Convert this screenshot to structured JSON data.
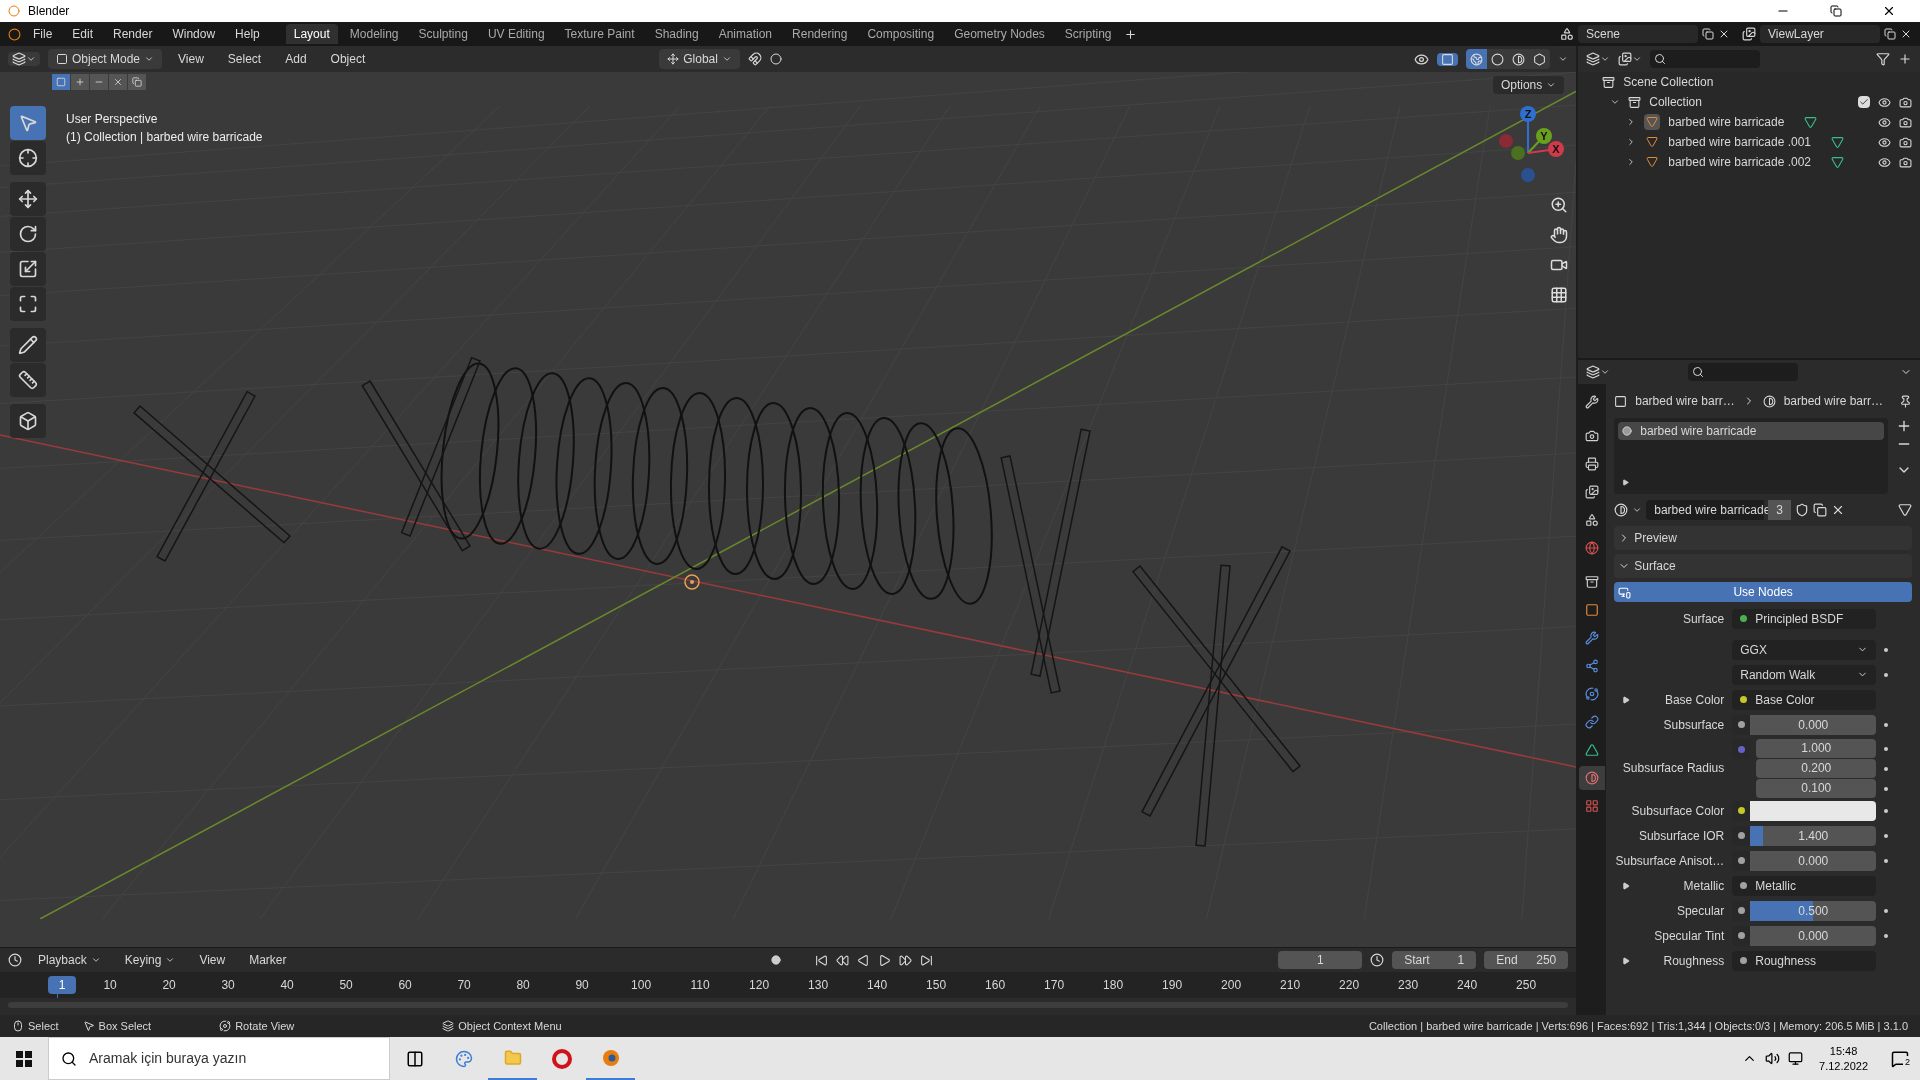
{
  "window": {
    "title": "Blender"
  },
  "menu": [
    "File",
    "Edit",
    "Render",
    "Window",
    "Help"
  ],
  "workspaces": [
    {
      "label": "Layout",
      "selected": true
    },
    {
      "label": "Modeling",
      "selected": false
    },
    {
      "label": "Sculpting",
      "selected": false
    },
    {
      "label": "UV Editing",
      "selected": false
    },
    {
      "label": "Texture Paint",
      "selected": false
    },
    {
      "label": "Shading",
      "selected": false
    },
    {
      "label": "Animation",
      "selected": false
    },
    {
      "label": "Rendering",
      "selected": false
    },
    {
      "label": "Compositing",
      "selected": false
    },
    {
      "label": "Geometry Nodes",
      "selected": false
    },
    {
      "label": "Scripting",
      "selected": false
    }
  ],
  "scene": "Scene",
  "view_layer": "ViewLayer",
  "viewport_header": {
    "mode": "Object Mode",
    "menus": [
      "View",
      "Select",
      "Add",
      "Object"
    ],
    "orientation": "Global",
    "options": "Options",
    "xray": true,
    "shading": [
      {
        "kind": "wireframe",
        "selected": true
      },
      {
        "kind": "solid",
        "selected": false
      },
      {
        "kind": "material",
        "selected": false
      },
      {
        "kind": "rendered",
        "selected": false
      }
    ]
  },
  "select_modes": [
    {
      "kind": "set",
      "selected": true
    },
    {
      "kind": "extend",
      "selected": false
    },
    {
      "kind": "subtract",
      "selected": false
    },
    {
      "kind": "difference",
      "selected": false
    },
    {
      "kind": "intersect",
      "selected": false
    }
  ],
  "viewport": {
    "overlay_lines": [
      "User Perspective",
      "(1) Collection | barbed wire barricade"
    ],
    "gizmo": [
      "Z",
      "Y",
      "X"
    ],
    "tools": [
      {
        "kind": "select",
        "selected": true
      },
      {
        "kind": "cursor",
        "selected": false
      },
      {
        "kind": "move",
        "selected": false
      },
      {
        "kind": "rotate",
        "selected": false
      },
      {
        "kind": "scale",
        "selected": false
      },
      {
        "kind": "transform",
        "selected": false
      },
      {
        "kind": "annotate",
        "selected": false
      },
      {
        "kind": "measure",
        "selected": false
      },
      {
        "kind": "add-cube",
        "selected": false
      }
    ]
  },
  "outliner": {
    "root": "Scene Collection",
    "children": [
      {
        "label": "Collection",
        "expanded": true,
        "checked": true,
        "children": [
          {
            "label": "barbed wire barricade",
            "expanded": false,
            "active": true
          },
          {
            "label": "barbed wire barricade .001",
            "expanded": false,
            "active": false
          },
          {
            "label": "barbed wire barricade .002",
            "expanded": false,
            "active": false
          }
        ]
      }
    ]
  },
  "properties": {
    "tabs": [
      {
        "kind": "tool",
        "selected": false
      },
      {
        "kind": "render",
        "selected": false
      },
      {
        "kind": "output",
        "selected": false
      },
      {
        "kind": "view-layer",
        "selected": false
      },
      {
        "kind": "scene",
        "selected": false
      },
      {
        "kind": "world",
        "selected": false
      },
      {
        "kind": "collection",
        "selected": false
      },
      {
        "kind": "object",
        "selected": false
      },
      {
        "kind": "modifiers",
        "selected": false
      },
      {
        "kind": "particles",
        "selected": false
      },
      {
        "kind": "physics",
        "selected": false
      },
      {
        "kind": "constraints",
        "selected": false
      },
      {
        "kind": "data",
        "selected": false
      },
      {
        "kind": "material",
        "selected": true
      },
      {
        "kind": "texture",
        "selected": false
      }
    ],
    "breadcrumb": [
      "barbed wire barr…",
      "barbed wire barr…"
    ],
    "slots": [
      {
        "label": "barbed wire barricade",
        "selected": true
      }
    ],
    "material": {
      "name": "barbed wire barricade",
      "users": "3"
    },
    "panels": [
      {
        "label": "Preview",
        "expanded": false
      },
      {
        "label": "Surface",
        "expanded": true
      }
    ],
    "use_nodes": "Use Nodes",
    "rows": [
      {
        "kind": "link",
        "label": "Surface",
        "color": "#4caf50",
        "value": "Principled BSDF"
      },
      {
        "kind": "dropdown",
        "value": "GGX"
      },
      {
        "kind": "dropdown",
        "value": "Random Walk"
      },
      {
        "kind": "link",
        "label": "Base Color",
        "color": "#c7c729",
        "value": "Base Color",
        "expandable": true
      },
      {
        "kind": "slider",
        "label": "Subsurface",
        "color": "#a1a1a1",
        "value": "0.000",
        "level": 0
      },
      {
        "kind": "vector",
        "label": "Subsurface Radius",
        "color": "#6363c7",
        "values": [
          "1.000",
          "0.200",
          "0.100"
        ]
      },
      {
        "kind": "swatch",
        "label": "Subsurface Color",
        "color": "#c7c729",
        "swatch": {
          "color": "#e8e8e8"
        }
      },
      {
        "kind": "slider",
        "label": "Subsurface IOR",
        "color": "#a1a1a1",
        "value": "1.400",
        "level": 0.1
      },
      {
        "kind": "slider",
        "label": "Subsurface Anisot…",
        "color": "#a1a1a1",
        "value": "0.000",
        "level": 0
      },
      {
        "kind": "link",
        "label": "Metallic",
        "color": "#a1a1a1",
        "value": "Metallic",
        "expandable": true
      },
      {
        "kind": "slider",
        "label": "Specular",
        "color": "#a1a1a1",
        "value": "0.500",
        "level": 0.5
      },
      {
        "kind": "slider",
        "label": "Specular Tint",
        "color": "#a1a1a1",
        "value": "0.000",
        "level": 0
      },
      {
        "kind": "link",
        "label": "Roughness",
        "color": "#a1a1a1",
        "value": "Roughness",
        "expandable": true
      }
    ]
  },
  "timeline": {
    "menus": [
      "Playback",
      "Keying",
      "View",
      "Marker"
    ],
    "current_frame": "1",
    "start_label": "Start",
    "start": "1",
    "end_label": "End",
    "end": "250",
    "ruler": [
      "1",
      "10",
      "20",
      "30",
      "40",
      "50",
      "60",
      "70",
      "80",
      "90",
      "100",
      "110",
      "120",
      "130",
      "140",
      "150",
      "160",
      "170",
      "180",
      "190",
      "200",
      "210",
      "220",
      "230",
      "240",
      "250"
    ]
  },
  "status_bar": {
    "hints": [
      {
        "kind": "left-click",
        "label": "Select"
      },
      {
        "kind": "drag",
        "label": "Box Select"
      },
      {
        "kind": "middle-click",
        "label": "Rotate View"
      },
      {
        "kind": "right-click",
        "label": "Object Context Menu"
      }
    ],
    "info": "Collection | barbed wire barricade | Verts:696 | Faces:692 | Tris:1,344 | Objects:0/3 | Memory: 206.5 MiB | 3.1.0"
  },
  "taskbar": {
    "search_placeholder": "Aramak için buraya yazın",
    "apps": [
      {
        "kind": "task-view",
        "running": false
      },
      {
        "kind": "paint",
        "running": false
      },
      {
        "kind": "explorer",
        "running": true
      },
      {
        "kind": "opera",
        "running": false
      },
      {
        "kind": "blender",
        "running": true
      }
    ],
    "time": "15:48",
    "date": "7.12.2022",
    "notifications": "2"
  }
}
